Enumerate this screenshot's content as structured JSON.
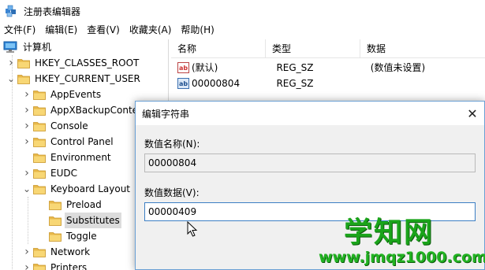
{
  "window": {
    "title": "注册表编辑器",
    "icon": "regedit-icon"
  },
  "menu": [
    "文件(F)",
    "编辑(E)",
    "查看(V)",
    "收藏夹(A)",
    "帮助(H)"
  ],
  "tree": {
    "root": "计算机",
    "items": [
      {
        "label": "HKEY_CLASSES_ROOT",
        "level": 1,
        "expander": "collapsed"
      },
      {
        "label": "HKEY_CURRENT_USER",
        "level": 1,
        "expander": "expanded"
      },
      {
        "label": "AppEvents",
        "level": 2,
        "expander": "collapsed"
      },
      {
        "label": "AppXBackupConte",
        "level": 2,
        "expander": "collapsed"
      },
      {
        "label": "Console",
        "level": 2,
        "expander": "collapsed"
      },
      {
        "label": "Control Panel",
        "level": 2,
        "expander": "collapsed"
      },
      {
        "label": "Environment",
        "level": 2,
        "expander": "none"
      },
      {
        "label": "EUDC",
        "level": 2,
        "expander": "collapsed"
      },
      {
        "label": "Keyboard Layout",
        "level": 2,
        "expander": "expanded"
      },
      {
        "label": "Preload",
        "level": 3,
        "expander": "none"
      },
      {
        "label": "Substitutes",
        "level": 3,
        "expander": "none",
        "selected": true
      },
      {
        "label": "Toggle",
        "level": 3,
        "expander": "none"
      },
      {
        "label": "Network",
        "level": 2,
        "expander": "collapsed"
      },
      {
        "label": "Printers",
        "level": 2,
        "expander": "collapsed"
      }
    ]
  },
  "list": {
    "columns": [
      "名称",
      "类型",
      "数据"
    ],
    "rows": [
      {
        "name": "(默认)",
        "type": "REG_SZ",
        "data": "(数值未设置)",
        "icon": "string-value-icon"
      },
      {
        "name": "00000804",
        "type": "REG_SZ",
        "data": "",
        "icon": "binary-value-icon"
      }
    ]
  },
  "dialog": {
    "title": "编辑字符串",
    "name_label": "数值名称(N):",
    "name_value": "00000804",
    "data_label": "数值数据(V):",
    "data_value": "00000409"
  },
  "watermark": {
    "title": "学知网",
    "url": "www.jmqz1000.com"
  }
}
